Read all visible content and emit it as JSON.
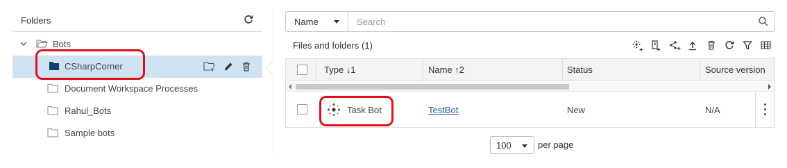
{
  "folders_panel": {
    "title": "Folders",
    "tree": [
      {
        "label": "Bots",
        "state": "expanded"
      },
      {
        "label": "CSharpCorner",
        "state": "selected"
      },
      {
        "label": "Document Workspace Processes"
      },
      {
        "label": "Rahul_Bots"
      },
      {
        "label": "Sample bots"
      }
    ]
  },
  "search": {
    "field": "Name",
    "placeholder": "Search"
  },
  "files": {
    "title": "Files and folders",
    "count": "(1)"
  },
  "table": {
    "columns": [
      "Type ↓1",
      "Name ↑2",
      "Status",
      "Source version"
    ],
    "rows": [
      {
        "type": "Task Bot",
        "name": "TestBot",
        "status": "New",
        "source_version": "N/A"
      }
    ]
  },
  "pagination": {
    "page_size": "100",
    "label": "per page"
  },
  "colors": {
    "selected_row": "#cfe2f1",
    "callout": "#e0101a",
    "link": "#1d5fa8"
  }
}
